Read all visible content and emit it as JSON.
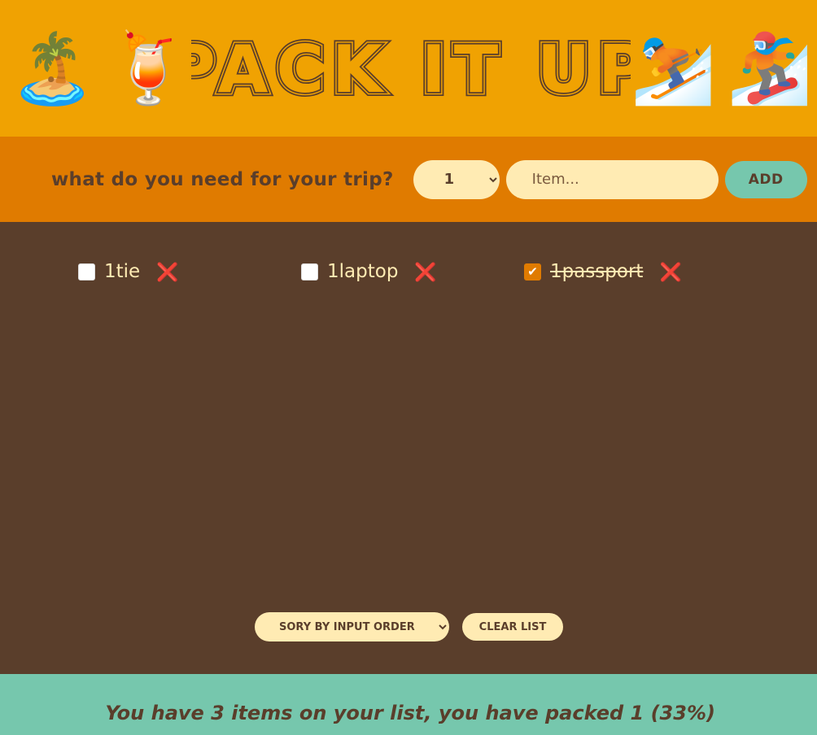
{
  "header": {
    "title": "PACK IT UP",
    "left_emojis": [
      {
        "glyph": "🏝️",
        "name": "island-icon"
      },
      {
        "glyph": "🍹",
        "name": "cocktail-icon"
      }
    ],
    "right_emojis": [
      {
        "glyph": "⛷️",
        "name": "skier-icon"
      },
      {
        "glyph": "🏂",
        "name": "snowboarder-icon"
      }
    ]
  },
  "form": {
    "question": "what do you need for your trip?",
    "quantity_selected": "1",
    "item_placeholder": "Item...",
    "add_label": "ADD"
  },
  "items": [
    {
      "quantity": "1",
      "description": "tie",
      "packed": false
    },
    {
      "quantity": "1",
      "description": "laptop",
      "packed": false
    },
    {
      "quantity": "1",
      "description": "passport",
      "packed": true
    }
  ],
  "delete_icon": "❌",
  "actions": {
    "sort_selected": "SORY BY INPUT ORDER",
    "clear_label": "CLEAR LIST"
  },
  "stats": {
    "text": "You have 3 items on your list, you have packed 1 (33%)"
  },
  "colors": {
    "header_bg": "#f0a202",
    "form_bg": "#e07b00",
    "list_bg": "#5a3e2b",
    "stats_bg": "#76c7ad",
    "text_light": "#ffebb3",
    "text_dark": "#5a3e2b",
    "delete_red": "#d94a1e"
  }
}
